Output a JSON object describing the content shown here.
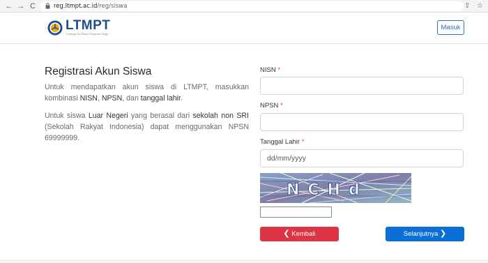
{
  "browser": {
    "url_domain": "reg.ltmpt.ac.id",
    "url_path": "/reg/siswa",
    "back_icon": "←",
    "forward_icon": "→",
    "reload_icon": "C",
    "share_icon": "⇪",
    "star_icon": "☆"
  },
  "header": {
    "logo_text": "LTMPT",
    "logo_subtitle": "Lembaga Tes Masuk Perguruan Tinggi",
    "login_label": "Masuk"
  },
  "intro": {
    "title": "Registrasi Akun Siswa",
    "desc1_a": "Untuk mendapatkan akun siswa di LTMPT, masukkan kombinasi ",
    "desc1_nisn": "NISN",
    "desc1_sep1": ", ",
    "desc1_npsn": "NPSN",
    "desc1_sep2": ", dan ",
    "desc1_dob": "tanggal lahir",
    "desc1_end": ".",
    "desc2_a": "Untuk siswa ",
    "desc2_ln": "Luar Negeri",
    "desc2_b": " yang berasal dari ",
    "desc2_sri": "sekolah non SRI",
    "desc2_c": " (Sekolah Rakyat Indonesia) dapat menggunakan NPSN 69999999."
  },
  "form": {
    "nisn_label": "NISN",
    "npsn_label": "NPSN",
    "dob_label": "Tanggal Lahir",
    "required_mark": "*",
    "dob_placeholder": "dd/mm/yyyy",
    "captcha_text": "NCHd",
    "back_label": "Kembali",
    "next_label": "Selanjutnya",
    "back_chevron": "❮",
    "next_chevron": "❯"
  },
  "colors": {
    "brand_blue": "#1f4e8c",
    "danger": "#dc3545",
    "primary": "#0b6fd6"
  }
}
